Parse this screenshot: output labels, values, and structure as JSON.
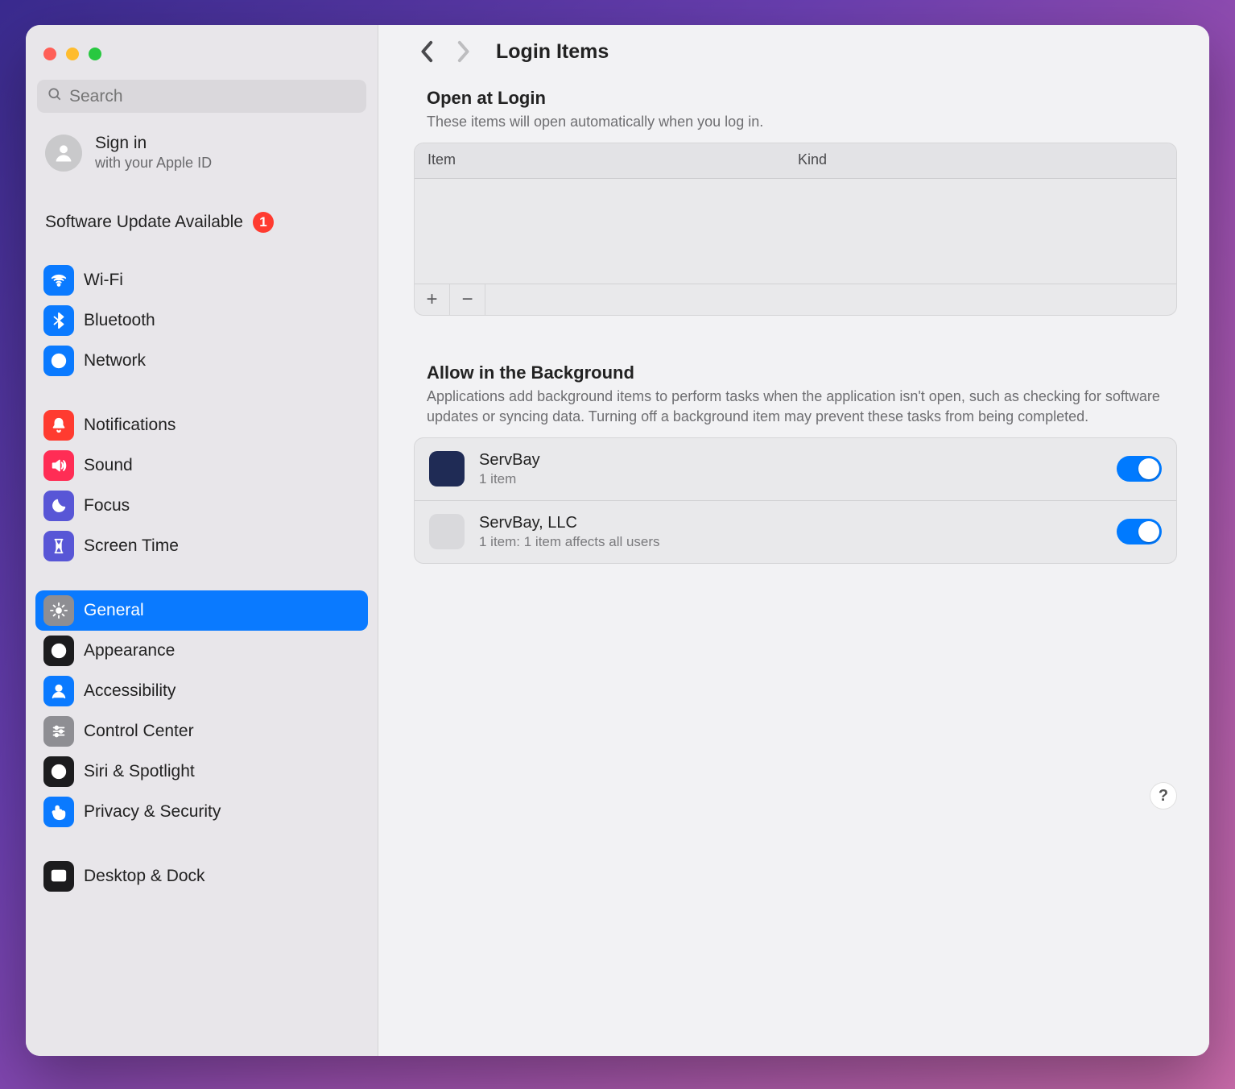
{
  "search": {
    "placeholder": "Search"
  },
  "signin": {
    "title": "Sign in",
    "subtitle": "with your Apple ID"
  },
  "update": {
    "label": "Software Update Available",
    "badge": "1"
  },
  "sidebar": {
    "items": [
      {
        "label": "Wi-Fi",
        "bg": "#0a7aff",
        "icon": "wifi"
      },
      {
        "label": "Bluetooth",
        "bg": "#0a7aff",
        "icon": "bluetooth"
      },
      {
        "label": "Network",
        "bg": "#0a7aff",
        "icon": "globe"
      },
      {
        "label": "Notifications",
        "bg": "#ff3b30",
        "icon": "bell"
      },
      {
        "label": "Sound",
        "bg": "#ff2d55",
        "icon": "speaker"
      },
      {
        "label": "Focus",
        "bg": "#5856d6",
        "icon": "moon"
      },
      {
        "label": "Screen Time",
        "bg": "#5856d6",
        "icon": "hourglass"
      },
      {
        "label": "General",
        "bg": "#8e8e93",
        "icon": "gear",
        "selected": true
      },
      {
        "label": "Appearance",
        "bg": "#1c1c1e",
        "icon": "circle-half"
      },
      {
        "label": "Accessibility",
        "bg": "#0a7aff",
        "icon": "person"
      },
      {
        "label": "Control Center",
        "bg": "#8e8e93",
        "icon": "sliders"
      },
      {
        "label": "Siri & Spotlight",
        "bg": "#1c1c1e",
        "icon": "siri"
      },
      {
        "label": "Privacy & Security",
        "bg": "#0a7aff",
        "icon": "hand"
      },
      {
        "label": "Desktop & Dock",
        "bg": "#1c1c1e",
        "icon": "dock"
      }
    ]
  },
  "header": {
    "title": "Login Items"
  },
  "open_at_login": {
    "title": "Open at Login",
    "desc": "These items will open automatically when you log in.",
    "col_item": "Item",
    "col_kind": "Kind",
    "add": "+",
    "remove": "−"
  },
  "background": {
    "title": "Allow in the Background",
    "desc": "Applications add background items to perform tasks when the application isn't open, such as checking for software updates or syncing data. Turning off a background item may prevent these tasks from being completed.",
    "rows": [
      {
        "name": "ServBay",
        "sub": "1 item",
        "bg": "#1f2b55",
        "enabled": true
      },
      {
        "name": "ServBay, LLC",
        "sub": "1 item: 1 item affects all users",
        "bg": "#d9d9dc",
        "enabled": true
      }
    ]
  },
  "help": "?"
}
